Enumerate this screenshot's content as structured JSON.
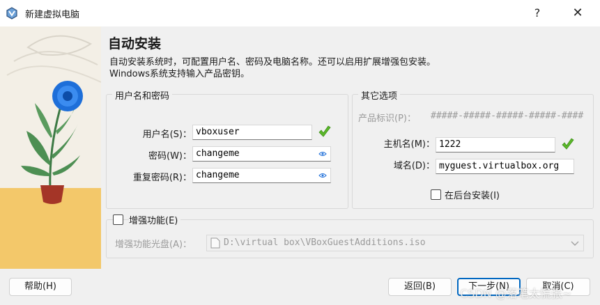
{
  "window": {
    "title": "新建虚拟电脑",
    "help": "?",
    "close": "✕"
  },
  "page": {
    "heading": "自动安装",
    "description_line1": "自动安装系统时，可配置用户名、密码及电脑名称。还可以启用扩展增强包安装。",
    "description_line2": "Windows系统支持输入产品密钥。"
  },
  "user_group": {
    "title": "用户名和密码",
    "username_label": "用户名(S)：",
    "username_value": "vboxuser",
    "password_label": "密码(W)：",
    "password_value": "changeme",
    "repeat_label": "重复密码(R)：",
    "repeat_value": "changeme"
  },
  "other_group": {
    "title": "其它选项",
    "product_key_label": "产品标识(P)：",
    "product_key_value": "#####-#####-#####-#####-####",
    "hostname_label": "主机名(M)：",
    "hostname_value": "1222",
    "domain_label": "域名(D)：",
    "domain_value": "myguest.virtualbox.org",
    "background_label": "在后台安装(I)"
  },
  "additions": {
    "checkbox_label": "增强功能(E)",
    "iso_label": "增强功能光盘(A)：",
    "iso_value": "D:\\virtual box\\VBoxGuestAdditions.iso"
  },
  "footer": {
    "help": "帮助(H)",
    "back": "返回(B)",
    "next": "下一步(N)",
    "cancel": "取消(C)"
  },
  "watermark": "CSDN @落笔太慌张~",
  "colors": {
    "accent": "#0067c0",
    "check_green": "#5cb82a",
    "flower_blue": "#1e6fd9"
  }
}
